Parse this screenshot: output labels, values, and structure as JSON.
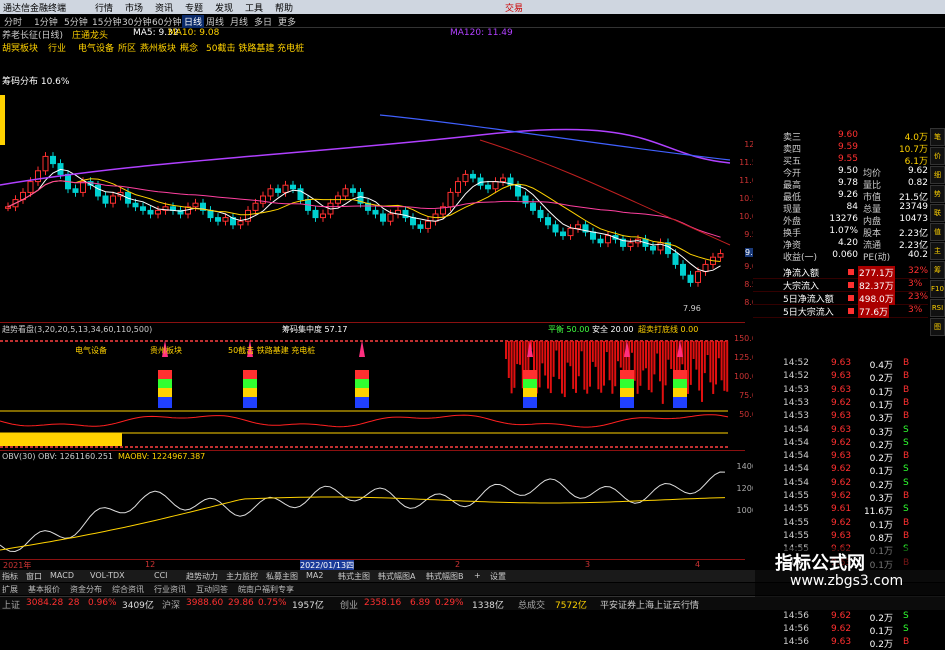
{
  "titlebar": {
    "app": "通达信金融终端",
    "menus": [
      "行情",
      "市场",
      "资讯",
      "专题",
      "发现",
      "工具",
      "帮助"
    ],
    "right": "交易"
  },
  "periods": [
    "分时",
    "1分钟",
    "5分钟",
    "15分钟",
    "30分钟",
    "60分钟",
    "日线",
    "周线",
    "月线",
    "多日",
    "更多"
  ],
  "active_period": "日线",
  "stock_line": {
    "name": "养老长征(日线)",
    "tag": "庄通龙头"
  },
  "ma": {
    "ma5": "MA5: 9.32",
    "ma10": "MA10: 9.08",
    "ma120": "MA120: 11.49"
  },
  "tags": [
    "胡冥板块",
    "行业",
    "电气设备",
    "所区",
    "燕州板块",
    "概念",
    "50截击 铁路基建 充电桩"
  ],
  "price_label": "筹码分布 10.6%",
  "low_label": "7.96",
  "current_price": "9.20",
  "price_axis": [
    "12.0",
    "11.50",
    "11.00",
    "10.50",
    "10.00",
    "9.50",
    "9.00",
    "8.50",
    "8.00"
  ],
  "indicator2": {
    "header": "趋势看盘(3,20,20,5,13,34,60,110,500)",
    "h2": "筹码集中度 57.17",
    "h3": "平衡 50.00",
    "h4": "安全 20.00",
    "h5": "超卖打底线 0.00",
    "labels": [
      "电气设备",
      "贵州板块",
      "50截击 铁路基建 充电桩"
    ],
    "axis": [
      "150.00",
      "125.00",
      "100.00",
      "75.00",
      "50.00"
    ]
  },
  "indicator3": {
    "header": "OBV(30) OBV: 1261160.251",
    "maobv": "MAOBV: 1224967.387",
    "axis": [
      "14000",
      "12000",
      "10000"
    ]
  },
  "date_labels": [
    "2021年",
    "12",
    "2022/01/13四",
    "2",
    "3",
    "4"
  ],
  "quote": [
    {
      "k": "卖三",
      "v": "9.60",
      "n": "4.0万"
    },
    {
      "k": "卖四",
      "v": "9.59",
      "n": "10.7万"
    },
    {
      "k": "买五",
      "v": "9.55",
      "n": "6.1万"
    },
    {
      "k": "今开",
      "v": "9.50",
      "k2": "均价",
      "v2": "9.62"
    },
    {
      "k": "最高",
      "v": "9.78",
      "k2": "量比",
      "v2": "0.82"
    },
    {
      "k": "最低",
      "v": "9.26",
      "k2": "市值",
      "v2": "21.5亿"
    },
    {
      "k": "现量",
      "v": "84",
      "k2": "总量",
      "v2": "23749"
    },
    {
      "k": "外盘",
      "v": "13276",
      "k2": "内盘",
      "v2": "10473"
    },
    {
      "k": "换手",
      "v": "1.07%",
      "k2": "股本",
      "v2": "2.23亿"
    },
    {
      "k": "净资",
      "v": "4.20",
      "k2": "流通",
      "v2": "2.23亿"
    },
    {
      "k": "收益(一)",
      "v": "0.060",
      "k2": "PE(动)",
      "v2": "40.2"
    }
  ],
  "flows": [
    {
      "k": "净流入额",
      "v": "277.1万",
      "p": "32%"
    },
    {
      "k": "大宗流入",
      "v": "82.37万",
      "p": "3%"
    },
    {
      "k": "5日净流入额",
      "v": "498.0万",
      "p": "23%"
    },
    {
      "k": "5日大宗流入",
      "v": "77.6万",
      "p": "3%"
    }
  ],
  "ticks": [
    {
      "t": "14:52",
      "p": "9.63",
      "v": "0.4万",
      "s": "B"
    },
    {
      "t": "14:52",
      "p": "9.63",
      "v": "0.2万",
      "s": "B"
    },
    {
      "t": "14:53",
      "p": "9.63",
      "v": "0.1万",
      "s": "B"
    },
    {
      "t": "14:53",
      "p": "9.62",
      "v": "0.1万",
      "s": "B"
    },
    {
      "t": "14:53",
      "p": "9.63",
      "v": "0.3万",
      "s": "B"
    },
    {
      "t": "14:54",
      "p": "9.63",
      "v": "0.3万",
      "s": "S"
    },
    {
      "t": "14:54",
      "p": "9.62",
      "v": "0.2万",
      "s": "S"
    },
    {
      "t": "14:54",
      "p": "9.63",
      "v": "0.2万",
      "s": "B"
    },
    {
      "t": "14:54",
      "p": "9.62",
      "v": "0.1万",
      "s": "S"
    },
    {
      "t": "14:54",
      "p": "9.62",
      "v": "0.2万",
      "s": "S"
    },
    {
      "t": "14:55",
      "p": "9.62",
      "v": "0.3万",
      "s": "B"
    },
    {
      "t": "14:55",
      "p": "9.61",
      "v": "11.6万",
      "s": "S"
    },
    {
      "t": "14:55",
      "p": "9.62",
      "v": "0.1万",
      "s": "B"
    },
    {
      "t": "14:55",
      "p": "9.63",
      "v": "0.8万",
      "s": "B"
    },
    {
      "t": "14:55",
      "p": "9.62",
      "v": "0.1万",
      "s": "S"
    },
    {
      "t": "14:55",
      "p": "9.63",
      "v": "0.1万",
      "s": "B"
    },
    {
      "t": "14:55",
      "p": "9.62",
      "v": "0.1万",
      "s": "S"
    },
    {
      "t": "14:55",
      "p": "9.62",
      "v": "0.2万",
      "s": "S"
    },
    {
      "t": "14:55",
      "p": "9.63",
      "v": "0.3万",
      "s": "B"
    },
    {
      "t": "14:56",
      "p": "9.62",
      "v": "0.2万",
      "s": "S"
    },
    {
      "t": "14:56",
      "p": "9.62",
      "v": "0.1万",
      "s": "S"
    },
    {
      "t": "14:56",
      "p": "9.63",
      "v": "0.2万",
      "s": "B"
    }
  ],
  "side_tabs": [
    "笔",
    "价",
    "细",
    "势",
    "联",
    "值",
    "主",
    "筹",
    "F10",
    "RSI",
    "图"
  ],
  "bottom_tabs": [
    "指标",
    "窗口",
    "MACD",
    "VOL-TDX",
    "CCI",
    "趋势动力",
    "主力监控",
    "私募主图",
    "MA2",
    "韩式主图",
    "韩式幅图A",
    "韩式幅图B",
    "+",
    "设置"
  ],
  "bottom_tabs2": [
    "扩展",
    "基本报价",
    "资金分布",
    "综合资讯",
    "行业资讯",
    "互动问答",
    "皖南户福利专享"
  ],
  "status": {
    "sh_label": "上证",
    "sh": "3084.28",
    "sh_chg": "28",
    "sh_pct": "0.96%",
    "sh_vol": "3409亿",
    "sz_label": "沪深",
    "sz": "3988.60",
    "sz_chg": "29.86",
    "sz_pct": "0.75%",
    "sz_vol": "1957亿",
    "cy_label": "创业",
    "cy": "2358.16",
    "cy_chg": "6.89",
    "cy_pct": "0.29%",
    "cy_vol": "1338亿",
    "total_label": "总成交",
    "total": "7572亿",
    "right": "平安证券上海上证云行情"
  },
  "watermark": {
    "line1": "指标公式网",
    "line2": "www.zbgs3.com"
  },
  "colors": {
    "up": "#ff3030",
    "down": "#00d0d0",
    "gold": "#ffd200",
    "purple": "#b040ff"
  }
}
